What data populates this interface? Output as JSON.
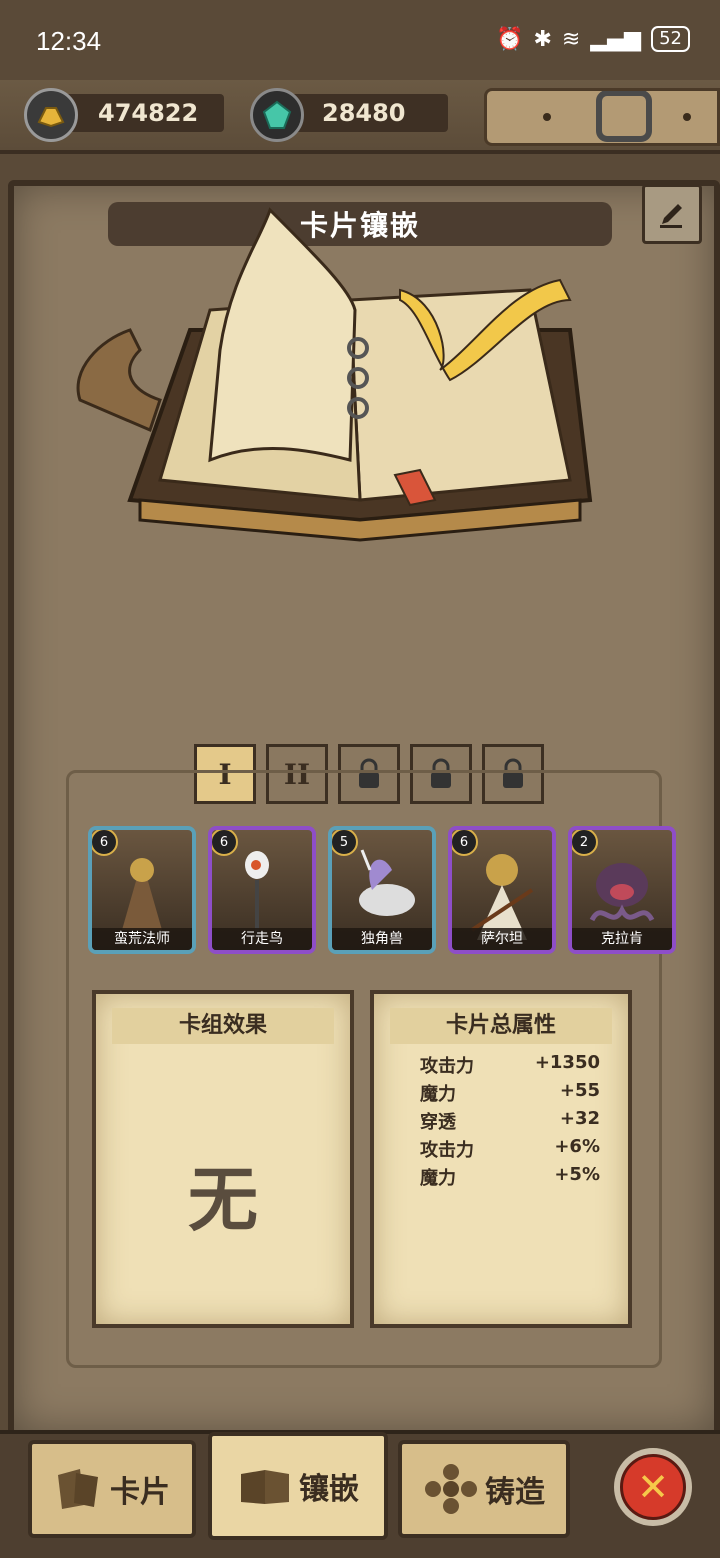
{
  "status_bar": {
    "time": "12:34",
    "battery": "52"
  },
  "resources": {
    "gold": "474822",
    "gems": "28480"
  },
  "header": {
    "title": "卡片镶嵌"
  },
  "tabs": [
    "I",
    "II"
  ],
  "cards": [
    {
      "level": "6",
      "name": "蛮荒法师"
    },
    {
      "level": "6",
      "name": "行走鸟"
    },
    {
      "level": "5",
      "name": "独角兽"
    },
    {
      "level": "6",
      "name": "萨尔坦"
    },
    {
      "level": "2",
      "name": "克拉肯"
    }
  ],
  "deck_effect": {
    "title": "卡组效果",
    "value": "无"
  },
  "card_totals": {
    "title": "卡片总属性",
    "rows": [
      {
        "label": "攻击力",
        "value": "+1350"
      },
      {
        "label": "魔力",
        "value": "+55"
      },
      {
        "label": "穿透",
        "value": "+32"
      },
      {
        "label": "攻击力",
        "value": "+6%"
      },
      {
        "label": "魔力",
        "value": "+5%"
      }
    ]
  },
  "bottom_nav": {
    "cards": "卡片",
    "inlay": "镶嵌",
    "forge": "铸造"
  },
  "colors": {
    "accent": "#e4c98a",
    "close": "#d63a2a"
  }
}
